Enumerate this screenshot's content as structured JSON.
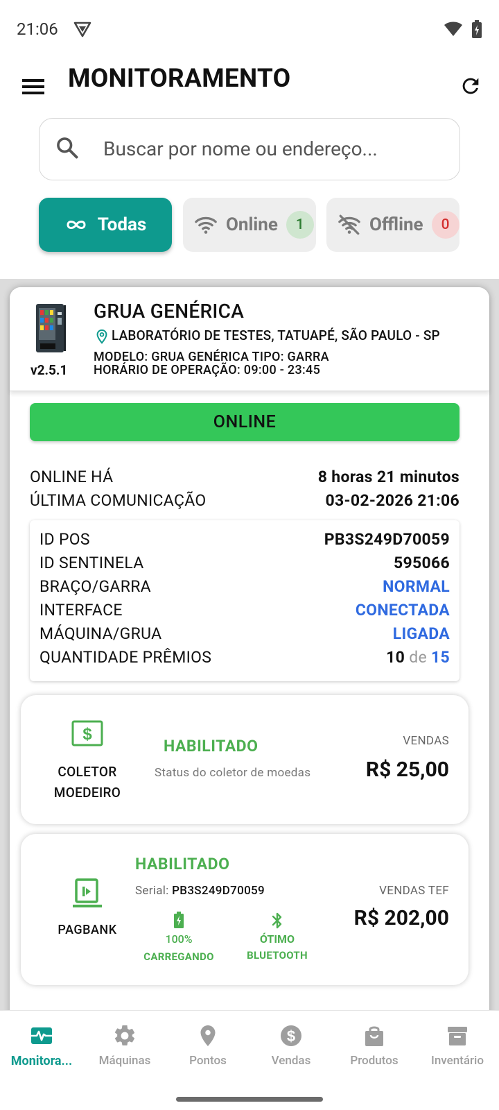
{
  "status_bar": {
    "time": "21:06"
  },
  "header": {
    "title": "MONITORAMENTO"
  },
  "search": {
    "placeholder": "Buscar por nome ou endereço..."
  },
  "filters": {
    "all_label": "Todas",
    "online_label": "Online",
    "online_count": "1",
    "offline_label": "Offline",
    "offline_count": "0"
  },
  "machine": {
    "name": "GRUA GENÉRICA",
    "location": "LABORATÓRIO DE TESTES, TATUAPÉ, SÃO PAULO - SP",
    "model_line": "MODELO: GRUA GENÉRICA   TIPO: GARRA",
    "hours_line": "HORÁRIO DE OPERAÇÃO: 09:00 - 23:45",
    "version": "v2.5.1",
    "status": "ONLINE",
    "online_for_label": "ONLINE HÁ",
    "online_for_value": "8 horas 21 minutos",
    "last_comm_label": "ÚLTIMA COMUNICAÇÃO",
    "last_comm_value": "03-02-2026 21:06",
    "details": {
      "pos_label": "ID POS",
      "pos_value": "PB3S249D70059",
      "sentinel_label": "ID SENTINELA",
      "sentinel_value": "595066",
      "arm_label": "BRAÇO/GARRA",
      "arm_value": "NORMAL",
      "interface_label": "INTERFACE",
      "interface_value": "CONECTADA",
      "machine_label": "MÁQUINA/GRUA",
      "machine_value": "LIGADA",
      "prizes_label": "QUANTIDADE PRÊMIOS",
      "prizes_current": "10",
      "prizes_of": "de",
      "prizes_total": "15"
    }
  },
  "coin_collector": {
    "label_line1": "COLETOR",
    "label_line2": "MOEDEIRO",
    "status": "HABILITADO",
    "description": "Status do coletor de moedas",
    "sales_label": "VENDAS",
    "sales_value": "R$ 25,00"
  },
  "pagbank": {
    "label": "PAGBANK",
    "status": "HABILITADO",
    "serial_label": "Serial:",
    "serial_value": "PB3S249D70059",
    "battery_pct": "100%",
    "battery_state": "CARREGANDO",
    "bt_quality": "ÓTIMO",
    "bt_label": "BLUETOOTH",
    "sales_label": "VENDAS TEF",
    "sales_value": "R$ 202,00"
  },
  "bottom_nav": {
    "monitoring": "Monitora...",
    "machines": "Máquinas",
    "points": "Pontos",
    "sales": "Vendas",
    "products": "Produtos",
    "inventory": "Inventário"
  },
  "colors": {
    "accent": "#0e9a8e",
    "online_green": "#34c759",
    "enabled_green": "#4caf50",
    "link_blue": "#2f6ae0"
  }
}
